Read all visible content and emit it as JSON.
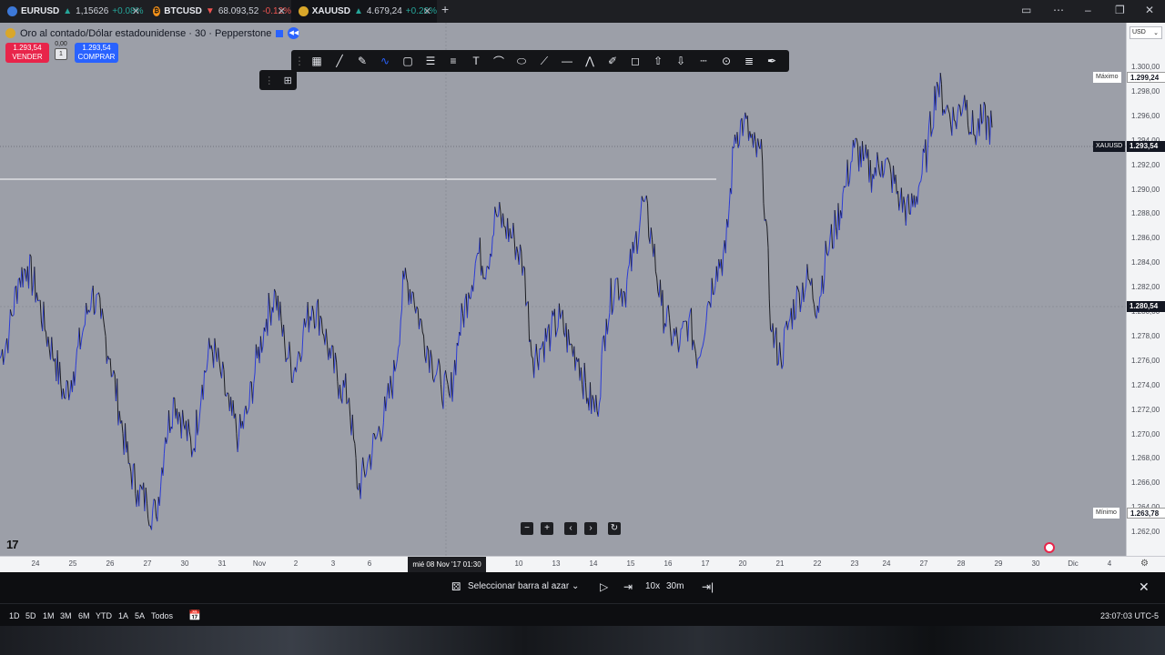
{
  "tabs": [
    {
      "symbol": "EURUSD",
      "price": "1,15626",
      "change": "+0.08%",
      "trend": "up",
      "coin_color": "#3c78d8"
    },
    {
      "symbol": "BTCUSD",
      "price": "68.093,52",
      "change": "-0.12%",
      "trend": "down",
      "coin_color": "#f7931a"
    },
    {
      "symbol": "XAUUSD",
      "price": "4.679,24",
      "change": "+0.26%",
      "trend": "up",
      "coin_color": "#d9a72a"
    }
  ],
  "new_tab_label": "+",
  "chart": {
    "instrument_title": "Oro al contado/Dólar estadounidense · 30 · Pepperstone",
    "sell_price": "1.293,54",
    "sell_label": "VENDER",
    "spread_top": "0,00",
    "spread_value": "1",
    "buy_price": "1.293,54",
    "buy_label": "COMPRAR",
    "currency": "USD",
    "symbol_tag": "XAUUSD",
    "max_label": "Máximo",
    "min_label": "Mínimo",
    "max_value": "1.299,24",
    "last_value": "1.293,54",
    "cursor_value": "1.280,54",
    "min_value": "1.263,78",
    "cursor_time": "mié 08 Nov '17   01:30"
  },
  "price_labels": [
    "1.300,00",
    "1.298,00",
    "1.296,00",
    "1.294,00",
    "1.292,00",
    "1.290,00",
    "1.288,00",
    "1.286,00",
    "1.284,00",
    "1.282,00",
    "1.280,00",
    "1.278,00",
    "1.276,00",
    "1.274,00",
    "1.272,00",
    "1.270,00",
    "1.268,00",
    "1.266,00",
    "1.264,00",
    "1.262,00"
  ],
  "time_labels": [
    "24",
    "25",
    "26",
    "27",
    "30",
    "31",
    "Nov",
    "2",
    "3",
    "6",
    "10",
    "13",
    "14",
    "15",
    "16",
    "17",
    "20",
    "21",
    "22",
    "23",
    "24",
    "27",
    "28",
    "29",
    "30",
    "Dic",
    "4"
  ],
  "replay": {
    "select_bar_label": "Seleccionar barra al azar",
    "speed": "10x",
    "interval": "30m"
  },
  "timeframes": [
    "1D",
    "5D",
    "1M",
    "3M",
    "6M",
    "YTD",
    "1A",
    "5A",
    "Todos"
  ],
  "clock": "23:07:03 UTC-5",
  "tv_logo": "17",
  "series_colors": {
    "up": "#2b3bd6",
    "down": "#1c1d22",
    "background": "#9c9fa8"
  },
  "chart_data": {
    "type": "line",
    "x_start": "24",
    "x_end": "29",
    "ylim": [
      1261.0,
      1301.5
    ],
    "y": [
      1276,
      1278,
      1282,
      1283,
      1281,
      1278,
      1276,
      1273,
      1275,
      1278,
      1281,
      1279,
      1276,
      1272,
      1268,
      1266,
      1265,
      1264,
      1270,
      1273,
      1271,
      1269,
      1274,
      1277,
      1275,
      1272,
      1270,
      1272,
      1276,
      1279,
      1281,
      1277,
      1275,
      1278,
      1280,
      1279,
      1276,
      1274,
      1273,
      1266,
      1268,
      1270,
      1272,
      1275,
      1282,
      1281,
      1278,
      1276,
      1274,
      1273,
      1278,
      1281,
      1284,
      1283,
      1287,
      1286,
      1285,
      1283,
      1276,
      1277,
      1278,
      1279,
      1277,
      1276,
      1273,
      1272,
      1279,
      1282,
      1281,
      1284,
      1288,
      1285,
      1280,
      1278,
      1277,
      1279,
      1276,
      1280,
      1283,
      1284,
      1293,
      1294,
      1292,
      1291,
      1278,
      1276,
      1279,
      1281,
      1282,
      1280,
      1284,
      1286,
      1289,
      1292,
      1291,
      1290,
      1291,
      1290,
      1288,
      1287,
      1289,
      1292,
      1297,
      1295,
      1294,
      1296,
      1293,
      1294,
      1293.54
    ]
  }
}
